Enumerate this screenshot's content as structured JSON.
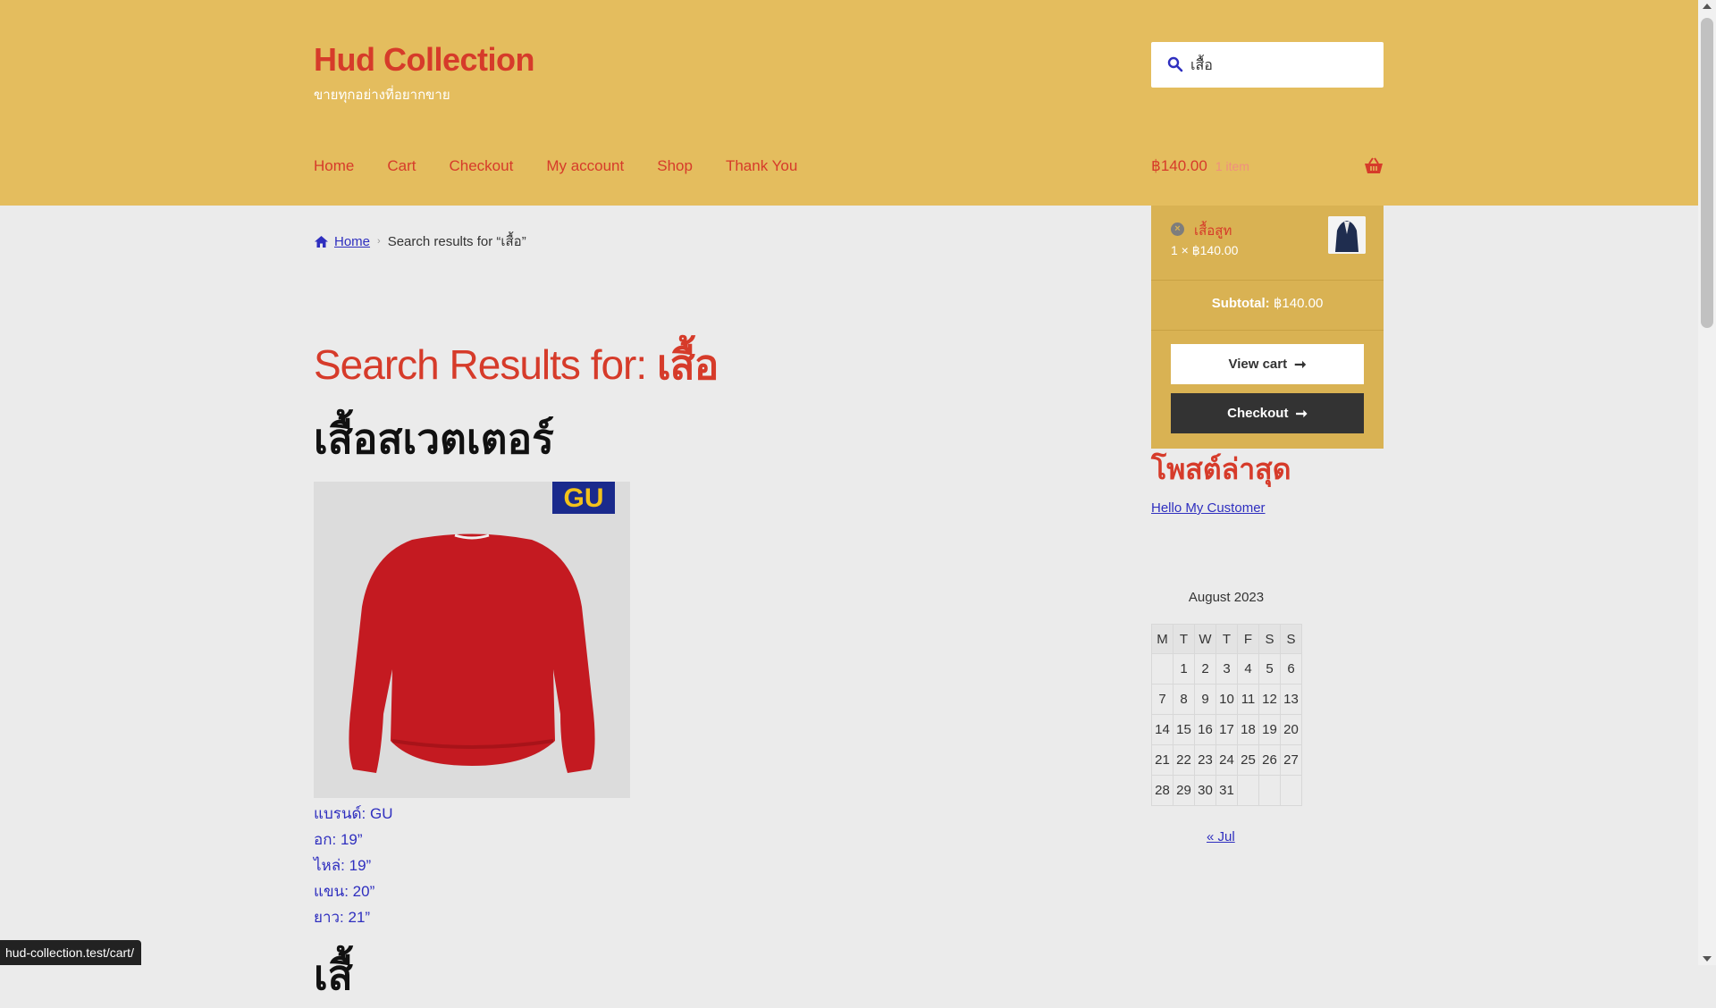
{
  "site": {
    "title": "Hud Collection",
    "tagline": "ขายทุกอย่างที่อยากขาย"
  },
  "search": {
    "value": "เสื้อ"
  },
  "nav": {
    "items": [
      "Home",
      "Cart",
      "Checkout",
      "My account",
      "Shop",
      "Thank You"
    ]
  },
  "cart_summary": {
    "amount": "฿140.00",
    "count": "1 item"
  },
  "mini_cart": {
    "item_name": "เสื้อสูท",
    "item_qty": "1 × ฿140.00",
    "subtotal_label": "Subtotal:",
    "subtotal_value": "฿140.00",
    "view_cart_label": "View cart",
    "checkout_label": "Checkout"
  },
  "breadcrumb": {
    "home": "Home",
    "current": "Search results for “เสื้อ”"
  },
  "main": {
    "title_prefix": "Search Results for:",
    "title_query": "เสื้อ",
    "product_title": "เสื้อสเวตเตอร์",
    "brand_logo": "GU",
    "specs": [
      {
        "label": "แบรนด์:",
        "value": "GU"
      },
      {
        "label": "อก:",
        "value": "19”"
      },
      {
        "label": "ไหล่:",
        "value": "19”"
      },
      {
        "label": "แขน:",
        "value": "20”"
      },
      {
        "label": "ยาว:",
        "value": "21”"
      }
    ],
    "next_title_partial": "เสื้"
  },
  "sidebar": {
    "recent_posts_title": "โพสต์ล่าสุด",
    "recent_posts": [
      "Hello My Customer"
    ],
    "calendar": {
      "caption": "August 2023",
      "headers": [
        "M",
        "T",
        "W",
        "T",
        "F",
        "S",
        "S"
      ],
      "weeks": [
        [
          "",
          "1",
          "2",
          "3",
          "4",
          "5",
          "6"
        ],
        [
          "7",
          "8",
          "9",
          "10",
          "11",
          "12",
          "13"
        ],
        [
          "14",
          "15",
          "16",
          "17",
          "18",
          "19",
          "20"
        ],
        [
          "21",
          "22",
          "23",
          "24",
          "25",
          "26",
          "27"
        ],
        [
          "28",
          "29",
          "30",
          "31",
          "",
          "",
          ""
        ]
      ],
      "prev_link": "« Jul"
    }
  },
  "status_bar": {
    "url": "hud-collection.test/cart/"
  },
  "colors": {
    "header_bg": "#e4bd5e",
    "accent": "#d63b2a",
    "link": "#2f2fbf",
    "page_bg": "#ebebeb",
    "mini_cart_bg": "#d9b253",
    "product_red": "#c41a21",
    "gu_blue": "#1a2a8c"
  },
  "icons": [
    "search-icon",
    "basket-icon",
    "remove-icon",
    "home-icon",
    "chevron-right-icon",
    "arrow-right-icon"
  ]
}
